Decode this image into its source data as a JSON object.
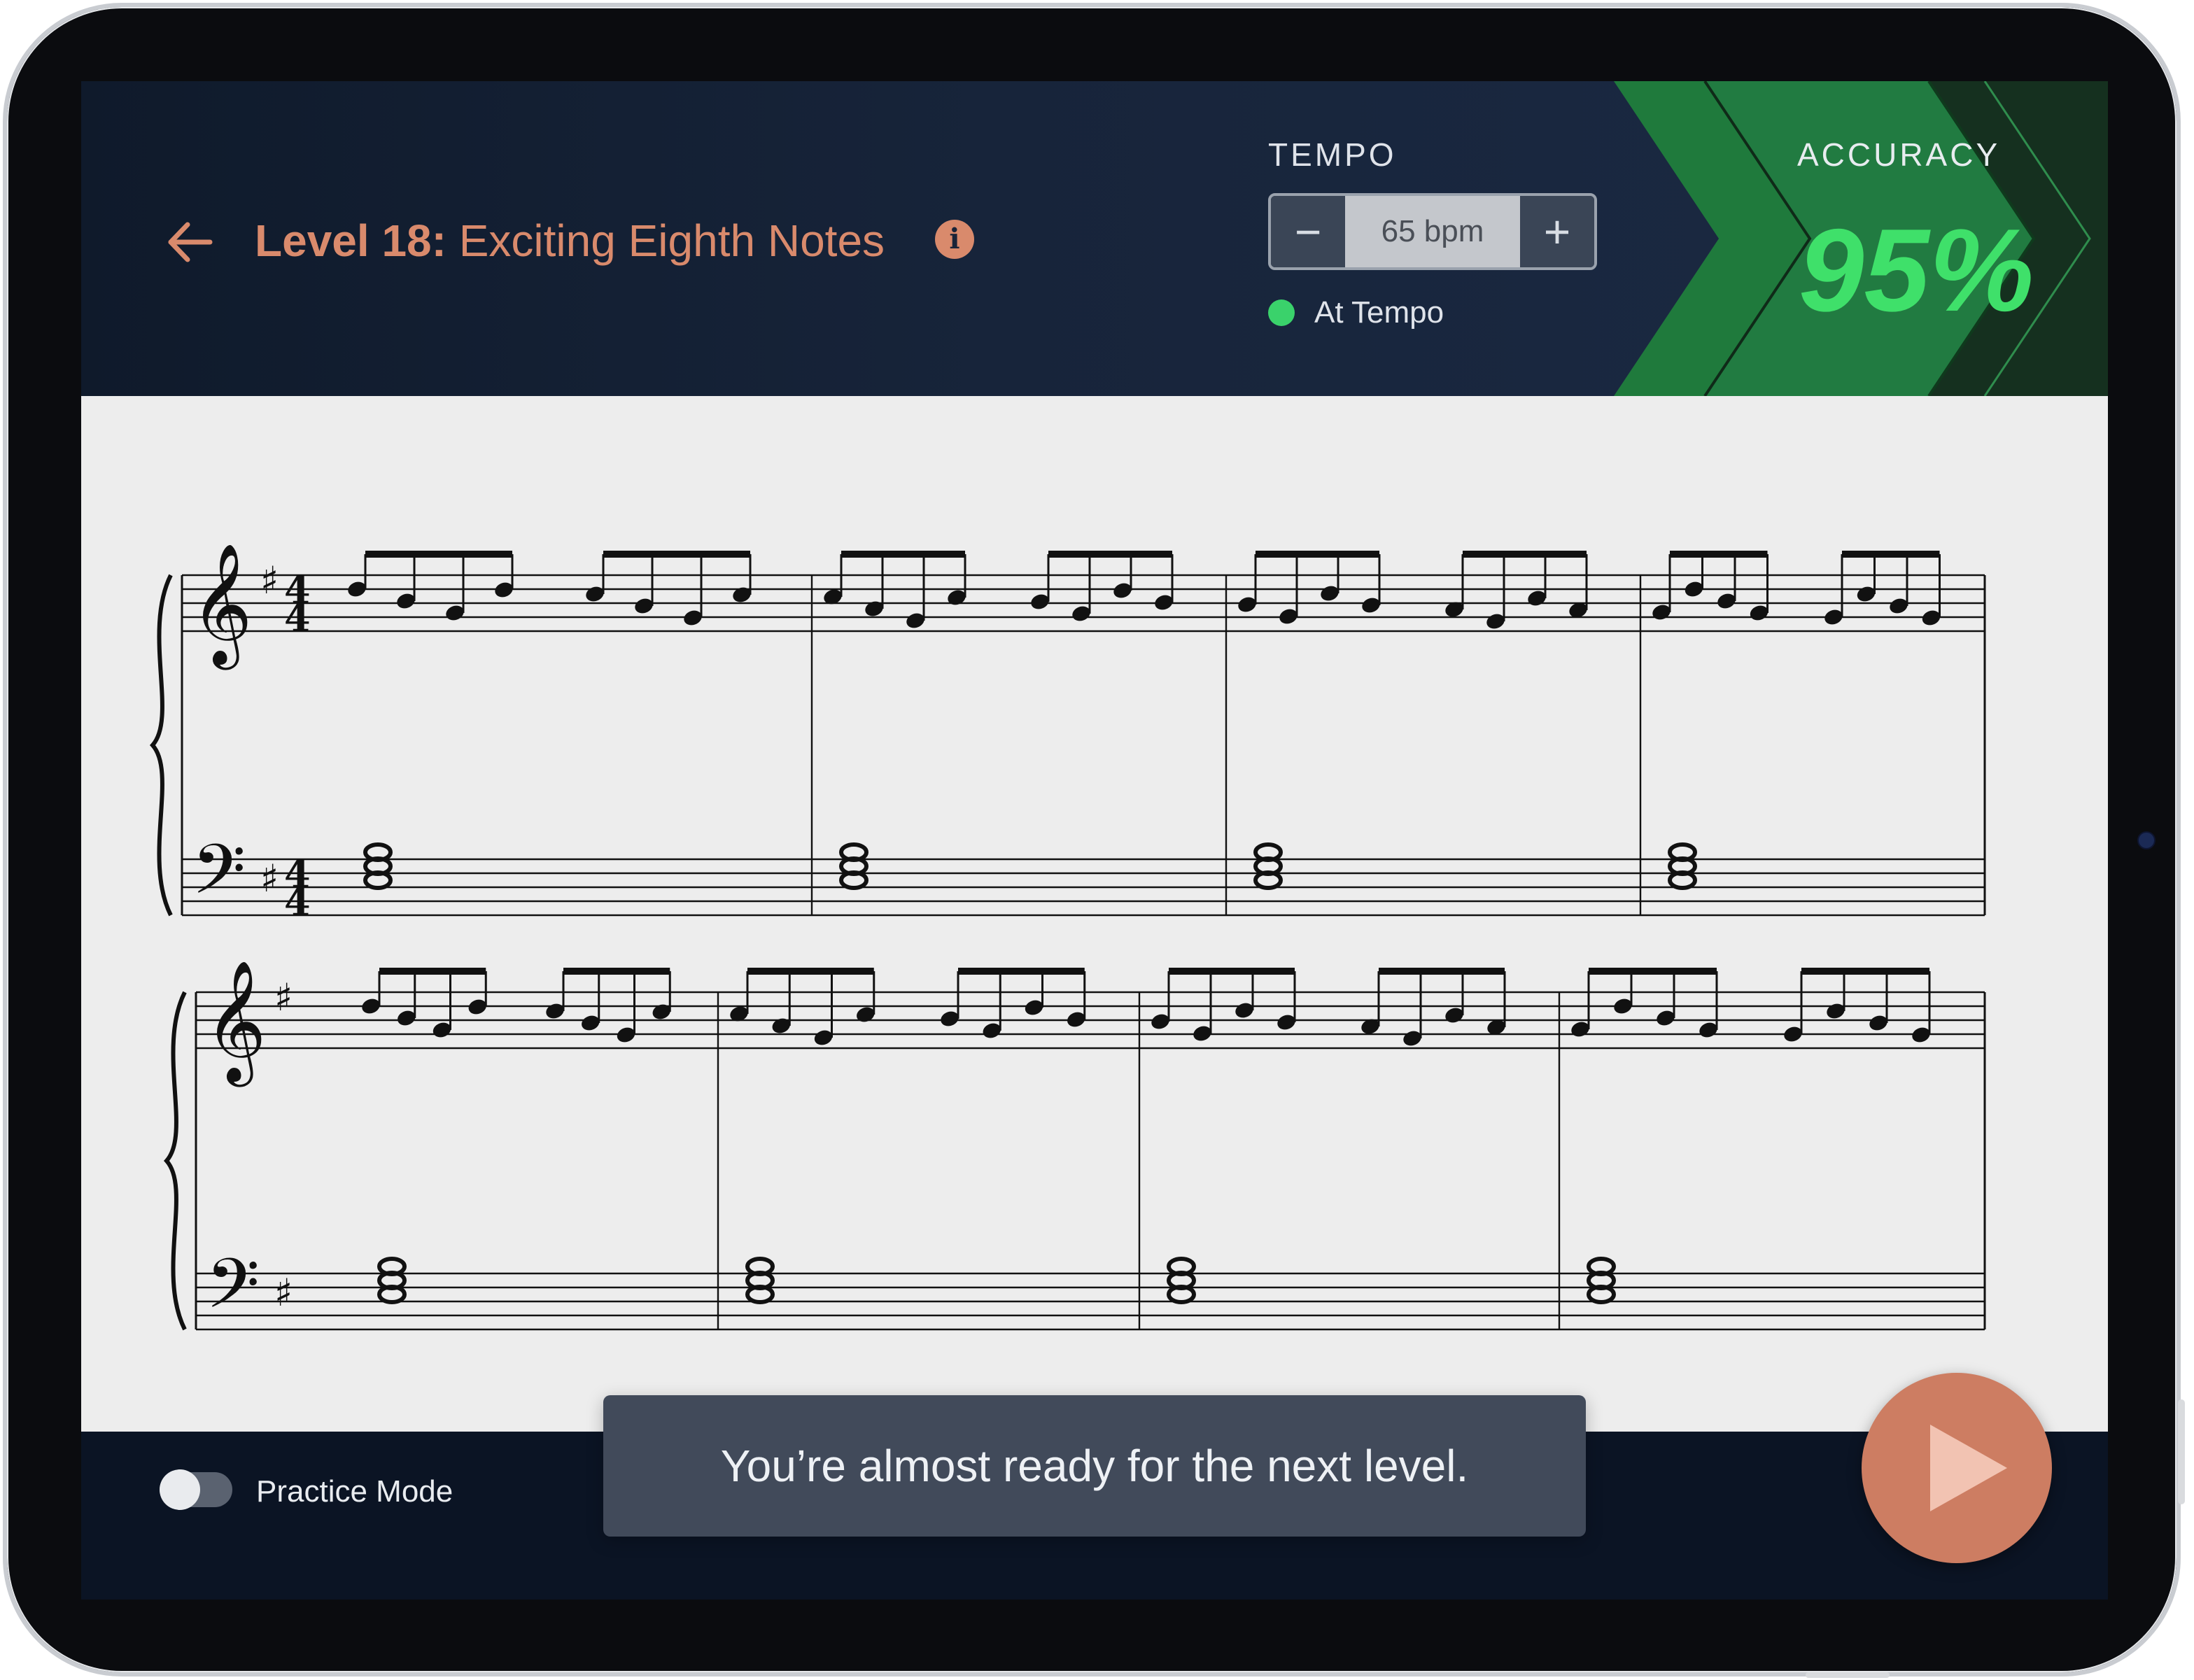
{
  "header": {
    "title_prefix": "Level 18:",
    "title_name": "Exciting Eighth Notes",
    "back_icon": "arrow-left-icon",
    "info_icon": "info-icon",
    "info_glyph": "i"
  },
  "tempo": {
    "label": "TEMPO",
    "minus": "−",
    "plus": "+",
    "value": "65 bpm",
    "status": "At Tempo",
    "status_color": "#3ad26b"
  },
  "accuracy": {
    "label": "ACCURACY",
    "value": "95%",
    "color": "#3fe06a"
  },
  "score": {
    "key_signature": "♯",
    "time_signature": [
      "4",
      "4"
    ],
    "systems": 2,
    "measures_per_system": 4
  },
  "bottom": {
    "practice_mode_label": "Practice Mode",
    "practice_mode_on": false,
    "toast": "You’re almost ready for the next level.",
    "play_icon": "play-icon"
  },
  "colors": {
    "accent": "#d98a6c",
    "header_bg": "#17243a",
    "sheet_bg": "#ededed",
    "play_button": "#cd7d62"
  }
}
